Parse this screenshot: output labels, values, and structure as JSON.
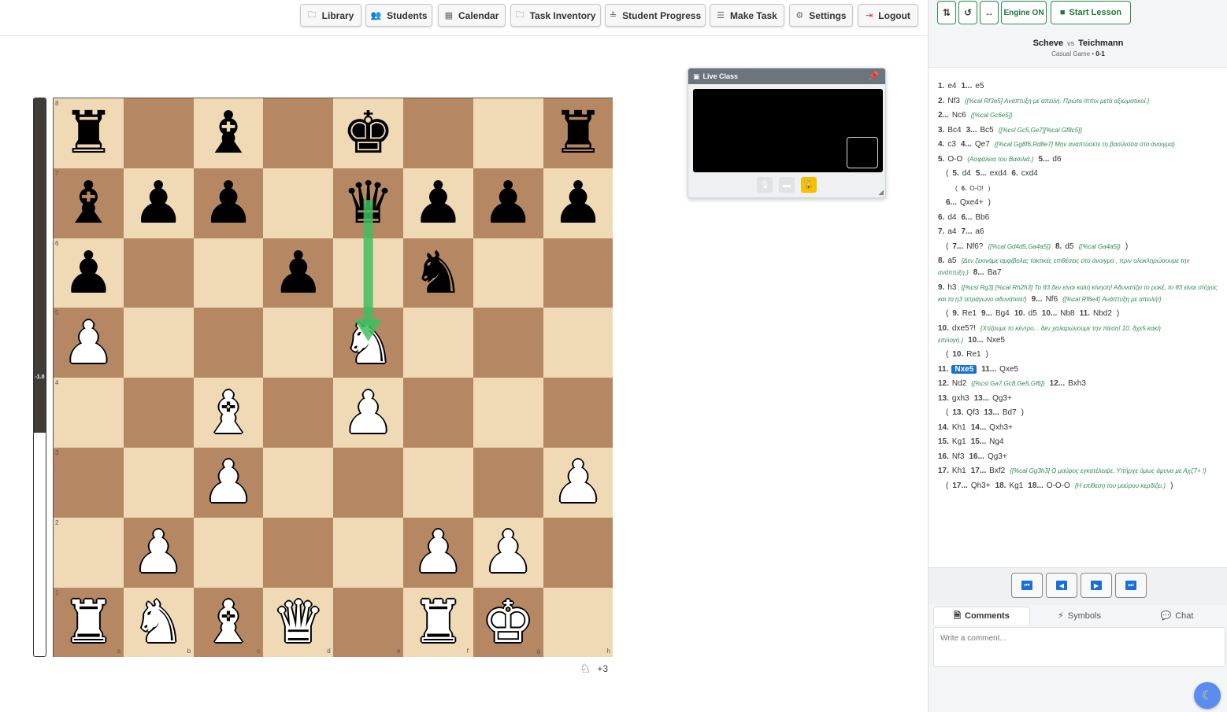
{
  "nav": {
    "library": "Library",
    "students": "Students",
    "calendar": "Calendar",
    "task_inventory": "Task Inventory",
    "student_progress": "Student Progress",
    "make_task": "Make Task",
    "settings": "Settings",
    "logout": "Logout"
  },
  "eval": {
    "label": "-1.0",
    "black_fraction": 0.6
  },
  "board": {
    "files": [
      "a",
      "b",
      "c",
      "d",
      "e",
      "f",
      "g",
      "h"
    ],
    "ranks": [
      "8",
      "7",
      "6",
      "5",
      "4",
      "3",
      "2",
      "1"
    ],
    "pieces": [
      {
        "sq": "a8",
        "p": "r"
      },
      {
        "sq": "c8",
        "p": "b"
      },
      {
        "sq": "e8",
        "p": "k"
      },
      {
        "sq": "h8",
        "p": "r"
      },
      {
        "sq": "a7",
        "p": "b"
      },
      {
        "sq": "b7",
        "p": "p"
      },
      {
        "sq": "c7",
        "p": "p"
      },
      {
        "sq": "e7",
        "p": "q"
      },
      {
        "sq": "f7",
        "p": "p"
      },
      {
        "sq": "g7",
        "p": "p"
      },
      {
        "sq": "h7",
        "p": "p"
      },
      {
        "sq": "a6",
        "p": "p"
      },
      {
        "sq": "d6",
        "p": "p"
      },
      {
        "sq": "f6",
        "p": "n"
      },
      {
        "sq": "a5",
        "p": "P"
      },
      {
        "sq": "e5",
        "p": "N"
      },
      {
        "sq": "c4",
        "p": "B"
      },
      {
        "sq": "e4",
        "p": "P"
      },
      {
        "sq": "c3",
        "p": "P"
      },
      {
        "sq": "h3",
        "p": "P"
      },
      {
        "sq": "b2",
        "p": "P"
      },
      {
        "sq": "f2",
        "p": "P"
      },
      {
        "sq": "g2",
        "p": "P"
      },
      {
        "sq": "a1",
        "p": "R"
      },
      {
        "sq": "b1",
        "p": "N"
      },
      {
        "sq": "c1",
        "p": "B"
      },
      {
        "sq": "d1",
        "p": "Q"
      },
      {
        "sq": "f1",
        "p": "R"
      },
      {
        "sq": "g1",
        "p": "K"
      }
    ],
    "arrow": {
      "from": "e7",
      "to": "e5",
      "color": "#3fbf5f"
    },
    "material_icon": "knight-icon",
    "material": "+3"
  },
  "live_class": {
    "title": "Live Class"
  },
  "toolbar": {
    "engine": "Engine ON",
    "start_lesson": "Start Lesson"
  },
  "game": {
    "white": "Scheve",
    "vs": "vs",
    "black": "Teichmann",
    "event": "Casual Game",
    "result": "0-1"
  },
  "moves": [
    {
      "type": "main",
      "parts": [
        {
          "t": "n",
          "v": "1."
        },
        {
          "t": "mv",
          "v": "e4"
        },
        {
          "t": "n",
          "v": "1..."
        },
        {
          "t": "mv",
          "v": "e5"
        }
      ]
    },
    {
      "type": "main",
      "parts": [
        {
          "t": "n",
          "v": "2."
        },
        {
          "t": "mv",
          "v": "Nf3"
        },
        {
          "t": "c",
          "v": "{[%cal Rf3e5] Ανάπτυξη με απειλή. Πρώτα ίπποι μετά αξιωματικοί.}"
        }
      ]
    },
    {
      "type": "main",
      "parts": [
        {
          "t": "n",
          "v": "2..."
        },
        {
          "t": "mv",
          "v": "Nc6"
        },
        {
          "t": "c",
          "v": "{[%cal Gc6e5]}"
        }
      ]
    },
    {
      "type": "main",
      "parts": [
        {
          "t": "n",
          "v": "3."
        },
        {
          "t": "mv",
          "v": "Bc4"
        },
        {
          "t": "n",
          "v": "3..."
        },
        {
          "t": "mv",
          "v": "Bc5"
        },
        {
          "t": "c",
          "v": "{[%csl Gc5,Ge7][%cal Gf8c5]}"
        }
      ]
    },
    {
      "type": "main",
      "parts": [
        {
          "t": "n",
          "v": "4."
        },
        {
          "t": "mv",
          "v": "c3"
        },
        {
          "t": "n",
          "v": "4..."
        },
        {
          "t": "mv",
          "v": "Qe7"
        },
        {
          "t": "c",
          "v": "{[%cal Gg8f6,Rd8e7] Μην αναπτύσετε τη βασίλισσα στο άνοιγμα}"
        }
      ]
    },
    {
      "type": "main",
      "parts": [
        {
          "t": "n",
          "v": "5."
        },
        {
          "t": "mv",
          "v": "O-O"
        },
        {
          "t": "c",
          "v": "{Ασφάλεια του Βασιλιά.}"
        },
        {
          "t": "n",
          "v": "5..."
        },
        {
          "t": "mv",
          "v": "d6"
        }
      ]
    },
    {
      "type": "var",
      "parts": [
        {
          "t": "p",
          "v": "("
        },
        {
          "t": "n",
          "v": "5."
        },
        {
          "t": "mv",
          "v": "d4"
        },
        {
          "t": "n",
          "v": "5..."
        },
        {
          "t": "mv",
          "v": "exd4"
        },
        {
          "t": "n",
          "v": "6."
        },
        {
          "t": "mv",
          "v": "cxd4"
        }
      ]
    },
    {
      "type": "var2",
      "parts": [
        {
          "t": "p",
          "v": "("
        },
        {
          "t": "n",
          "v": "6."
        },
        {
          "t": "mv",
          "v": "O-O!"
        },
        {
          "t": "p",
          "v": ")"
        }
      ]
    },
    {
      "type": "var",
      "parts": [
        {
          "t": "n",
          "v": "6..."
        },
        {
          "t": "mv",
          "v": "Qxe4+"
        },
        {
          "t": "p",
          "v": ")"
        }
      ]
    },
    {
      "type": "main",
      "parts": [
        {
          "t": "n",
          "v": "6."
        },
        {
          "t": "mv",
          "v": "d4"
        },
        {
          "t": "n",
          "v": "6..."
        },
        {
          "t": "mv",
          "v": "Bb6"
        }
      ]
    },
    {
      "type": "main",
      "parts": [
        {
          "t": "n",
          "v": "7."
        },
        {
          "t": "mv",
          "v": "a4"
        },
        {
          "t": "n",
          "v": "7..."
        },
        {
          "t": "mv",
          "v": "a6"
        }
      ]
    },
    {
      "type": "var",
      "parts": [
        {
          "t": "p",
          "v": "("
        },
        {
          "t": "n",
          "v": "7..."
        },
        {
          "t": "mv",
          "v": "Nf6?"
        },
        {
          "t": "c",
          "v": "{[%cal Gd4d5,Ga4a5]}"
        },
        {
          "t": "n",
          "v": "8."
        },
        {
          "t": "mv",
          "v": "d5"
        },
        {
          "t": "c",
          "v": "{[%cal Ga4a5]}"
        },
        {
          "t": "p",
          "v": ")"
        }
      ]
    },
    {
      "type": "main",
      "parts": [
        {
          "t": "n",
          "v": "8."
        },
        {
          "t": "mv",
          "v": "a5"
        },
        {
          "t": "c",
          "v": "{Δεν ξεκινάμε αμφίβολες τακτικές επιθέσεις στο άνοιγμα , πριν ολοκληρώσουμε την ανάπτυξη.}"
        },
        {
          "t": "n",
          "v": "8..."
        },
        {
          "t": "mv",
          "v": "Ba7"
        }
      ]
    },
    {
      "type": "main",
      "parts": [
        {
          "t": "n",
          "v": "9."
        },
        {
          "t": "mv",
          "v": "h3"
        },
        {
          "t": "c",
          "v": "{[%csl Rg3] [%cal Rh2h3] Το θ3 δεν είναι καλή κίνηση! Αδυνατίζει το ροκέ, το θ3 είναι στόχος και το η3 τετράγωνο αδυνάτισε!}"
        },
        {
          "t": "n",
          "v": "9..."
        },
        {
          "t": "mv",
          "v": "Nf6"
        },
        {
          "t": "c",
          "v": "{[%cal Rf6e4] Ανάπτυξη με απειλή!}"
        }
      ]
    },
    {
      "type": "var",
      "parts": [
        {
          "t": "p",
          "v": "("
        },
        {
          "t": "n",
          "v": "9."
        },
        {
          "t": "mv",
          "v": "Re1"
        },
        {
          "t": "n",
          "v": "9..."
        },
        {
          "t": "mv",
          "v": "Bg4"
        },
        {
          "t": "n",
          "v": "10."
        },
        {
          "t": "mv",
          "v": "d5"
        },
        {
          "t": "n",
          "v": "10..."
        },
        {
          "t": "mv",
          "v": "Nb8"
        },
        {
          "t": "n",
          "v": "11."
        },
        {
          "t": "mv",
          "v": "Nbd2"
        },
        {
          "t": "p",
          "v": ")"
        }
      ]
    },
    {
      "type": "main",
      "parts": [
        {
          "t": "n",
          "v": "10."
        },
        {
          "t": "mv",
          "v": "dxe5?!"
        },
        {
          "t": "c",
          "v": "{Χτίζουμε το κέντρο... δεν χαλαρώνουμε την πίεση! 10. δχε5 κακή επιλογή.}"
        },
        {
          "t": "n",
          "v": "10..."
        },
        {
          "t": "mv",
          "v": "Nxe5"
        }
      ]
    },
    {
      "type": "var",
      "parts": [
        {
          "t": "p",
          "v": "("
        },
        {
          "t": "n",
          "v": "10."
        },
        {
          "t": "mv",
          "v": "Re1"
        },
        {
          "t": "p",
          "v": ")"
        }
      ]
    },
    {
      "type": "main",
      "parts": [
        {
          "t": "n",
          "v": "11."
        },
        {
          "t": "cur",
          "v": "Nxe5"
        },
        {
          "t": "n",
          "v": "11..."
        },
        {
          "t": "mv",
          "v": "Qxe5"
        }
      ]
    },
    {
      "type": "main",
      "parts": [
        {
          "t": "n",
          "v": "12."
        },
        {
          "t": "mv",
          "v": "Nd2"
        },
        {
          "t": "c",
          "v": "{[%csl Ga7,Gc8,Ge5,Gf6]}"
        },
        {
          "t": "n",
          "v": "12..."
        },
        {
          "t": "mv",
          "v": "Bxh3"
        }
      ]
    },
    {
      "type": "main",
      "parts": [
        {
          "t": "n",
          "v": "13."
        },
        {
          "t": "mv",
          "v": "gxh3"
        },
        {
          "t": "n",
          "v": "13..."
        },
        {
          "t": "mv",
          "v": "Qg3+"
        }
      ]
    },
    {
      "type": "var",
      "parts": [
        {
          "t": "p",
          "v": "("
        },
        {
          "t": "n",
          "v": "13."
        },
        {
          "t": "mv",
          "v": "Qf3"
        },
        {
          "t": "n",
          "v": "13..."
        },
        {
          "t": "mv",
          "v": "Bd7"
        },
        {
          "t": "p",
          "v": ")"
        }
      ]
    },
    {
      "type": "main",
      "parts": [
        {
          "t": "n",
          "v": "14."
        },
        {
          "t": "mv",
          "v": "Kh1"
        },
        {
          "t": "n",
          "v": "14..."
        },
        {
          "t": "mv",
          "v": "Qxh3+"
        }
      ]
    },
    {
      "type": "main",
      "parts": [
        {
          "t": "n",
          "v": "15."
        },
        {
          "t": "mv",
          "v": "Kg1"
        },
        {
          "t": "n",
          "v": "15..."
        },
        {
          "t": "mv",
          "v": "Ng4"
        }
      ]
    },
    {
      "type": "main",
      "parts": [
        {
          "t": "n",
          "v": "16."
        },
        {
          "t": "mv",
          "v": "Nf3"
        },
        {
          "t": "n",
          "v": "16..."
        },
        {
          "t": "mv",
          "v": "Qg3+"
        }
      ]
    },
    {
      "type": "main",
      "parts": [
        {
          "t": "n",
          "v": "17."
        },
        {
          "t": "mv",
          "v": "Kh1"
        },
        {
          "t": "n",
          "v": "17..."
        },
        {
          "t": "mv",
          "v": "Bxf2"
        },
        {
          "t": "c",
          "v": "{[%cal Gg3h3] Ο μαύρος εγκατέλειψε. Υπήρχε όμως άμυνα με Αχζ7+ !}"
        }
      ]
    },
    {
      "type": "var",
      "parts": [
        {
          "t": "p",
          "v": "("
        },
        {
          "t": "n",
          "v": "17..."
        },
        {
          "t": "mv",
          "v": "Qh3+"
        },
        {
          "t": "n",
          "v": "18."
        },
        {
          "t": "mv",
          "v": "Kg1"
        },
        {
          "t": "n",
          "v": "18..."
        },
        {
          "t": "mv",
          "v": "O-O-O"
        },
        {
          "t": "c",
          "v": "{Η επίθεση του μαύρου κερδίζει.}"
        },
        {
          "t": "p",
          "v": ")"
        }
      ]
    }
  ],
  "tabs": {
    "comments": "Comments",
    "symbols": "Symbols",
    "chat": "Chat"
  },
  "comment": {
    "placeholder": "Write a comment..."
  }
}
